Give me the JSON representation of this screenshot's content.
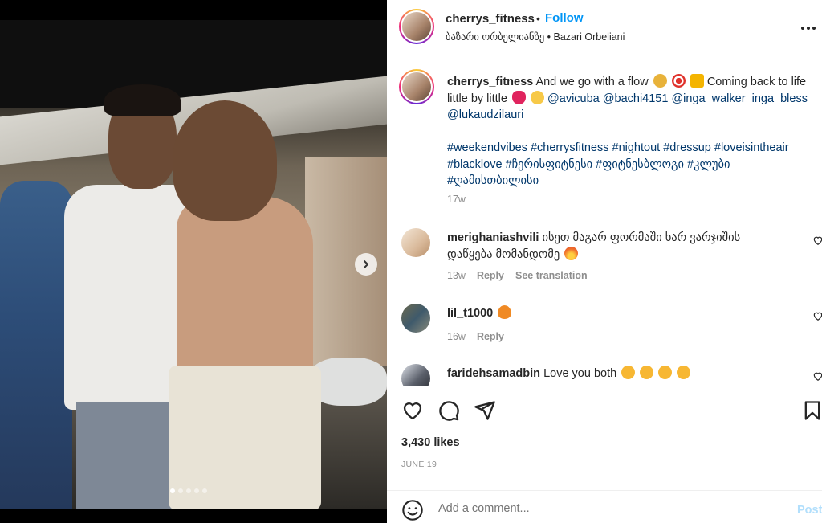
{
  "post": {
    "username": "cherrys_fitness",
    "follow_label": "Follow",
    "separator": "•",
    "location": "ბაზარი ორბელიანზე • Bazari Orbeliani",
    "more_label": "•••"
  },
  "caption": {
    "username": "cherrys_fitness",
    "text_1": "And we go with a flow",
    "text_2": "Coming back to life little by little",
    "mentions": [
      "@avicuba",
      "@bachi4151",
      "@inga_walker_inga_bless",
      "@lukaudzilauri"
    ],
    "hashtags": "#weekendvibes #cherrysfitness #nightout #dressup #loveisintheair #blacklove #ჩერისფიტნესი #ფიტნესბლოგი #კლუბი #ღამისთბილისი",
    "time": "17w"
  },
  "comments": [
    {
      "username": "merighaniashvili",
      "text": "ისეთ მაგარ ფორმაში ხარ ვარჯიშის დაწყება მომანდომე",
      "time": "13w",
      "reply_label": "Reply",
      "translate_label": "See translation"
    },
    {
      "username": "lil_t1000",
      "text": "",
      "time": "16w",
      "reply_label": "Reply"
    },
    {
      "username": "faridehsamadbin",
      "text": "Love you both",
      "time": "",
      "reply_label": ""
    }
  ],
  "actions": {
    "icons": [
      "heart-icon",
      "comment-icon",
      "share-icon",
      "bookmark-icon"
    ],
    "likes": "3,430 likes",
    "date": "JUNE 19"
  },
  "add_comment": {
    "placeholder": "Add a comment...",
    "post_label": "Post"
  },
  "carousel": {
    "slide_count": 5,
    "active_index": 0
  },
  "colors": {
    "link_blue": "#0095f6",
    "mention_blue": "#00376b",
    "muted": "#8e8e8e",
    "post_disabled": "#b2dffc"
  }
}
